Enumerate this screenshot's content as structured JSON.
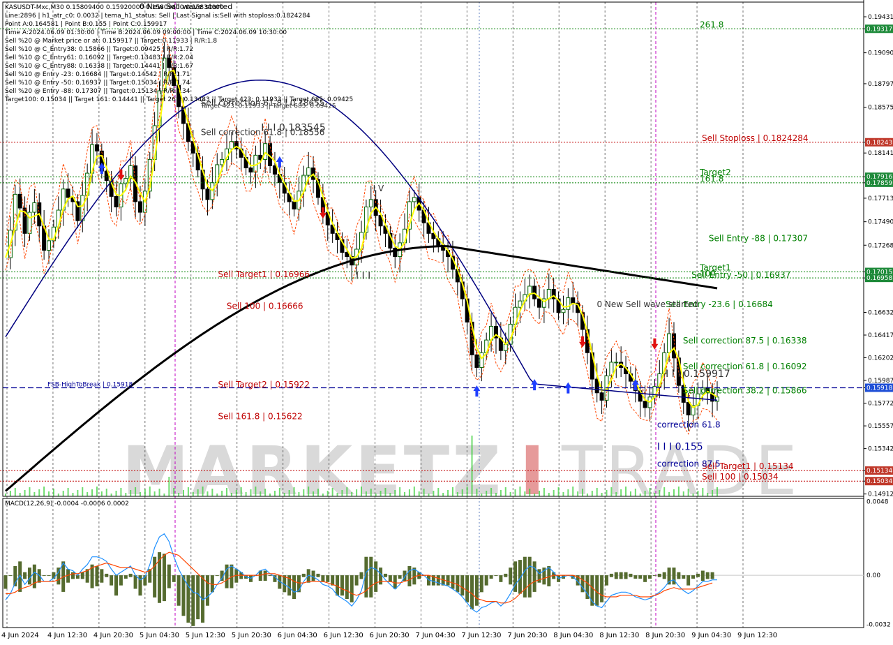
{
  "colors": {
    "background": "#ffffff",
    "border": "#000000",
    "grid": "#c8c8c8",
    "axis_text": "#000000",
    "candle_up": "#006400",
    "candle_down": "#000000",
    "sma_fast": "#ffff00",
    "ma_blue": "#000080",
    "ma_black": "#000000",
    "band": "#ff4500",
    "fsb_line": "#000096",
    "level_red": "#c00000",
    "level_green": "#008000",
    "level_dark": "#333333",
    "macd_line": "#1e90ff",
    "signal_line": "#ff4500",
    "histogram": "#556b2f",
    "volume": "#32cd32",
    "price_badge_red": "#c0392b",
    "price_badge_green": "#1e8a3a",
    "price_badge_blue": "#1f4fd6",
    "session_line": "#c000c0",
    "watermark": "#d9d9d9",
    "watermark_red": "#e69a9a"
  },
  "header_lines": [
    "KASUSDT-Mxc,M30  0.15809400 0.15920000 0.15809400 0.15830000",
    "Line:2896 | h1_atr_c0: 0.0032 | tema_h1_status: Sell | Last Signal is:Sell with stoploss:0.1824284",
    "Point A:0.164581 | Point B:0.155 | Point C:0.159917",
    "Time A:2024.06.09 01:30:00 | Time B:2024.06.09 09:00:00 | Time C:2024.06.09 10:30:00",
    "Sell %20 @ Market price or at: 0.159917 || Target:0.11933 | R/R:1.8",
    "Sell %10 @ C_Entry38: 0.15866 || Target:0.09425 | R/R:1.72",
    "Sell %10 @ C_Entry61: 0.16092 || Target:0.13483 | R/R:2.04",
    "Sell %10 @ C_Entry88: 0.16338 || Target:0.14441 | R/R:1.67",
    "Sell %10 @ Entry -23: 0.16684 || Target:0.14542 | R/R:1.71",
    "Sell %10 @ Entry -50: 0.16937 || Target:0.15034 | R/R:1.74",
    "Sell %20 @ Entry -88: 0.17307 || Target:0.15134 | R/R:2.34",
    "Target100: 0.15034 || Target 161: 0.14441 || Target 261: 0.13483 || Target 423: 0.11933 || Target 685: 0.09425"
  ],
  "header_overlay": "0 New Sell wave started",
  "chart_data": {
    "type": "line",
    "symbol": "KASUSDT-Mxc,M30",
    "ylim": [
      0.1489,
      0.1957
    ],
    "y_ticks": [
      "0.19431",
      "0.19317",
      "0.19090",
      "0.18797",
      "0.18575",
      "0.18243",
      "0.18141",
      "0.17916",
      "0.17859",
      "0.17713",
      "0.17490",
      "0.17268",
      "0.17015",
      "0.16958",
      "0.16632",
      "0.16417",
      "0.16202",
      "0.15987",
      "0.15918",
      "0.15772",
      "0.15557",
      "0.15342",
      "0.15134",
      "0.15034",
      "0.14912"
    ],
    "x_ticks": [
      "4 Jun 2024",
      "4 Jun 12:30",
      "4 Jun 20:30",
      "5 Jun 04:30",
      "5 Jun 12:30",
      "5 Jun 20:30",
      "6 Jun 04:30",
      "6 Jun 12:30",
      "6 Jun 20:30",
      "7 Jun 04:30",
      "7 Jun 12:30",
      "7 Jun 20:30",
      "8 Jun 04:30",
      "8 Jun 12:30",
      "8 Jun 20:30",
      "9 Jun 04:30",
      "9 Jun 12:30"
    ],
    "badges": [
      {
        "price": "0.19317",
        "kind": "green"
      },
      {
        "price": "0.18243",
        "kind": "red"
      },
      {
        "price": "0.17916",
        "kind": "green"
      },
      {
        "price": "0.17859",
        "kind": "green"
      },
      {
        "price": "0.17015",
        "kind": "green"
      },
      {
        "price": "0.16958",
        "kind": "green"
      },
      {
        "price": "0.15918",
        "kind": "blue"
      },
      {
        "price": "0.15134",
        "kind": "red"
      },
      {
        "price": "0.15034",
        "kind": "red"
      }
    ],
    "levels": [
      {
        "price": 0.19317,
        "label": "261.8",
        "color": "green",
        "style": "dash"
      },
      {
        "price": 0.18243,
        "label": "Sell Stoploss | 0.1824284",
        "color": "red",
        "style": "dash"
      },
      {
        "price": 0.17916,
        "label": "Target2",
        "color": "green",
        "style": "dash"
      },
      {
        "price": 0.17859,
        "label": "161.8",
        "color": "green",
        "style": "dash"
      },
      {
        "price": 0.17015,
        "label": "Target1",
        "color": "green",
        "style": "dash"
      },
      {
        "price": 0.16958,
        "label": "100",
        "color": "green",
        "style": "dash"
      },
      {
        "price": 0.15918,
        "label": "FSB-HighToBreak | 0.15918",
        "color": "blue",
        "style": "dash"
      },
      {
        "price": 0.15134,
        "label": "Sell Target1 | 0.15134",
        "color": "red",
        "style": "dash"
      },
      {
        "price": 0.15034,
        "label": "Sell 100 | 0.15034",
        "color": "red",
        "style": "dash"
      }
    ],
    "annotations": [
      {
        "text": "Sell Entry -88 | 0.17307",
        "price": 0.17307,
        "x_frac": 0.82,
        "color": "green"
      },
      {
        "text": "Sell Entry -50 | 0.16937",
        "price": 0.16958,
        "x_frac": 0.8,
        "color": "green"
      },
      {
        "text": "Sell Entry -23.6 | 0.16684",
        "price": 0.1668,
        "x_frac": 0.77,
        "color": "green"
      },
      {
        "text": "Sell correction 87.5 | 0.16338",
        "price": 0.16338,
        "x_frac": 0.79,
        "color": "green"
      },
      {
        "text": "Sell correction 61.8 | 0.16092",
        "price": 0.16092,
        "x_frac": 0.79,
        "color": "green"
      },
      {
        "text": "Sell correction 38.2 | 0.15866",
        "price": 0.15866,
        "x_frac": 0.79,
        "color": "green"
      },
      {
        "text": "Sell Target1 | 0.16966",
        "price": 0.16966,
        "x_frac": 0.25,
        "color": "red"
      },
      {
        "text": "Sell 100 | 0.16666",
        "price": 0.16666,
        "x_frac": 0.26,
        "color": "red"
      },
      {
        "text": "Sell Target2 | 0.15922",
        "price": 0.15922,
        "x_frac": 0.25,
        "color": "red"
      },
      {
        "text": "Sell 161.8 | 0.15622",
        "price": 0.15622,
        "x_frac": 0.25,
        "color": "red"
      },
      {
        "text": "I I I 0.183545",
        "price": 0.1835,
        "x_frac": 0.3,
        "color": "dark"
      },
      {
        "text": "I I I 0.159917",
        "price": 0.1602,
        "x_frac": 0.77,
        "color": "dark"
      },
      {
        "text": "I I I 0.155",
        "price": 0.1533,
        "x_frac": 0.76,
        "color": "blue"
      },
      {
        "text": "correction 61.8",
        "price": 0.1554,
        "x_frac": 0.76,
        "color": "blue"
      },
      {
        "text": "correction 87.5",
        "price": 0.1517,
        "x_frac": 0.76,
        "color": "blue"
      },
      {
        "text": "I V",
        "price": 0.1778,
        "x_frac": 0.43,
        "color": "dark"
      },
      {
        "text": "I I I",
        "price": 0.1695,
        "x_frac": 0.41,
        "color": "dark"
      },
      {
        "text": "0 New Sell wave started",
        "price": 0.1668,
        "x_frac": 0.69,
        "color": "dark"
      },
      {
        "text": "Sell correction 61.8 | 0.18556",
        "price": 0.1831,
        "x_frac": 0.23,
        "color": "dark"
      },
      {
        "text": "Target 423: 0.11933 || Target 685: 0.09425",
        "price": 0.1857,
        "x_frac": 0.23,
        "color": "dark"
      },
      {
        "text": "Sell correction 61.8 | 0.18655",
        "price": 0.1859,
        "x_frac": 0.23,
        "color": "dark"
      }
    ],
    "series": [
      {
        "name": "close",
        "values": [
          0.1715,
          0.1741,
          0.1775,
          0.1762,
          0.1738,
          0.1758,
          0.1767,
          0.1745,
          0.1722,
          0.1731,
          0.1744,
          0.176,
          0.178,
          0.1772,
          0.1768,
          0.175,
          0.1774,
          0.1795,
          0.1822,
          0.1816,
          0.1797,
          0.1788,
          0.1773,
          0.1763,
          0.1785,
          0.179,
          0.1802,
          0.1768,
          0.1758,
          0.1778,
          0.1808,
          0.184,
          0.1873,
          0.1904,
          0.1895,
          0.1878,
          0.1858,
          0.1842,
          0.1825,
          0.1814,
          0.1798,
          0.178,
          0.177,
          0.1786,
          0.1803,
          0.1808,
          0.1818,
          0.1825,
          0.1818,
          0.181,
          0.18,
          0.1796,
          0.1812,
          0.1808,
          0.1823,
          0.1802,
          0.1794,
          0.1786,
          0.1776,
          0.1768,
          0.1761,
          0.1778,
          0.1793,
          0.18,
          0.1789,
          0.1772,
          0.1758,
          0.1746,
          0.1738,
          0.1732,
          0.172,
          0.1716,
          0.1708,
          0.1723,
          0.1739,
          0.1763,
          0.177,
          0.1755,
          0.1745,
          0.1738,
          0.1724,
          0.1716,
          0.1729,
          0.1742,
          0.1768,
          0.1772,
          0.176,
          0.1748,
          0.1738,
          0.1733,
          0.1727,
          0.1722,
          0.1716,
          0.1704,
          0.1692,
          0.1676,
          0.1654,
          0.1623,
          0.1611,
          0.1625,
          0.1637,
          0.165,
          0.1639,
          0.1627,
          0.1633,
          0.1652,
          0.1668,
          0.1674,
          0.168,
          0.1688,
          0.1676,
          0.1668,
          0.1676,
          0.1685,
          0.1676,
          0.1663,
          0.1666,
          0.1677,
          0.1672,
          0.1663,
          0.1647,
          0.1625,
          0.16,
          0.1587,
          0.158,
          0.1603,
          0.1616,
          0.1616,
          0.1611,
          0.1605,
          0.1598,
          0.1589,
          0.1579,
          0.1573,
          0.1583,
          0.1593,
          0.1605,
          0.1625,
          0.1643,
          0.162,
          0.1594,
          0.1578,
          0.1566,
          0.1575,
          0.1586,
          0.1592,
          0.1587,
          0.1579,
          0.1583
        ]
      },
      {
        "name": "macd",
        "values": [
          -0.0016,
          -0.0012,
          -0.0005,
          0.0,
          -0.0006,
          -0.0002,
          0.0002,
          0.0,
          -0.0004,
          -0.0004,
          -0.0002,
          0.0002,
          0.0008,
          0.0004,
          0.0003,
          0.0,
          0.0004,
          0.0007,
          0.0012,
          0.0012,
          0.0011,
          0.0009,
          0.0004,
          0.0,
          0.0002,
          0.0004,
          0.0006,
          0.0,
          -0.0003,
          -0.0001,
          0.0007,
          0.0018,
          0.0025,
          0.0027,
          0.0022,
          0.0012,
          0.0004,
          -0.0002,
          -0.0007,
          -0.0011,
          -0.0012,
          -0.0016,
          -0.0014,
          -0.0011,
          -0.0006,
          -0.0002,
          0.0004,
          0.0006,
          0.0004,
          0.0002,
          -0.0001,
          -0.0002,
          0.0,
          0.0003,
          0.0004,
          0.0001,
          -0.0001,
          -0.0004,
          -0.0006,
          -0.0008,
          -0.0011,
          -0.001,
          -0.0004,
          0.0,
          -0.0001,
          -0.0003,
          -0.0006,
          -0.0007,
          -0.0009,
          -0.0013,
          -0.0015,
          -0.0017,
          -0.002,
          -0.0016,
          -0.001,
          0.0002,
          0.0005,
          0.0004,
          0.0001,
          -0.0003,
          -0.0006,
          -0.0009,
          -0.0006,
          -0.0001,
          0.0003,
          0.0004,
          0.0002,
          0.0,
          -0.0003,
          -0.0004,
          -0.0005,
          -0.0006,
          -0.0007,
          -0.0009,
          -0.0011,
          -0.0014,
          -0.0018,
          -0.0022,
          -0.0024,
          -0.0021,
          -0.002,
          -0.0018,
          -0.0017,
          -0.002,
          -0.0017,
          -0.0012,
          -0.0006,
          -0.0002,
          0.0003,
          0.0006,
          0.0005,
          0.0001,
          0.0003,
          0.0005,
          0.0002,
          -0.0002,
          -0.0001,
          0.0,
          -0.0001,
          -0.0004,
          -0.0008,
          -0.0012,
          -0.0017,
          -0.002,
          -0.0021,
          -0.0017,
          -0.0013,
          -0.0012,
          -0.0011,
          -0.0011,
          -0.0012,
          -0.0014,
          -0.0015,
          -0.0016,
          -0.0015,
          -0.0013,
          -0.0011,
          -0.0008,
          -0.0004,
          -0.0003,
          -0.0007,
          -0.001,
          -0.0012,
          -0.001,
          -0.0007,
          -0.0004,
          -0.0004,
          -0.0003,
          -0.0003
        ]
      },
      {
        "name": "signal",
        "values": [
          -0.0012,
          -0.0012,
          -0.0011,
          -0.0009,
          -0.0008,
          -0.0007,
          -0.0005,
          -0.0004,
          -0.0004,
          -0.0004,
          -0.0004,
          -0.0003,
          -0.0001,
          0.0,
          0.0001,
          0.0001,
          0.0002,
          0.0003,
          0.0005,
          0.0006,
          0.0007,
          0.0008,
          0.0007,
          0.0006,
          0.0005,
          0.0005,
          0.0005,
          0.0004,
          0.0003,
          0.0002,
          0.0003,
          0.0006,
          0.001,
          0.0013,
          0.0015,
          0.0014,
          0.0013,
          0.001,
          0.0007,
          0.0004,
          0.0001,
          -0.0002,
          -0.0005,
          -0.0006,
          -0.0006,
          -0.0005,
          -0.0003,
          -0.0001,
          0.0,
          0.0,
          0.0,
          0.0,
          0.0,
          0.0,
          0.0001,
          0.0001,
          0.0001,
          0.0,
          -0.0001,
          -0.0002,
          -0.0004,
          -0.0005,
          -0.0005,
          -0.0004,
          -0.0004,
          -0.0004,
          -0.0004,
          -0.0005,
          -0.0006,
          -0.0007,
          -0.0009,
          -0.001,
          -0.0012,
          -0.0013,
          -0.0012,
          -0.001,
          -0.0007,
          -0.0005,
          -0.0004,
          -0.0004,
          -0.0004,
          -0.0005,
          -0.0005,
          -0.0004,
          -0.0003,
          -0.0001,
          0.0,
          0.0,
          0.0,
          -0.0001,
          -0.0002,
          -0.0003,
          -0.0004,
          -0.0005,
          -0.0006,
          -0.0008,
          -0.001,
          -0.0012,
          -0.0015,
          -0.0016,
          -0.0017,
          -0.0017,
          -0.0017,
          -0.0018,
          -0.0018,
          -0.0017,
          -0.0015,
          -0.0012,
          -0.0009,
          -0.0006,
          -0.0004,
          -0.0003,
          -0.0002,
          -0.0001,
          0.0,
          0.0,
          0.0,
          0.0,
          0.0,
          -0.0001,
          -0.0003,
          -0.0005,
          -0.0008,
          -0.0011,
          -0.0013,
          -0.0014,
          -0.0014,
          -0.0014,
          -0.0013,
          -0.0013,
          -0.0013,
          -0.0013,
          -0.0014,
          -0.0014,
          -0.0014,
          -0.0013,
          -0.0012,
          -0.001,
          -0.0009,
          -0.0008,
          -0.0009,
          -0.0009,
          -0.0009,
          -0.0009,
          -0.0008,
          -0.0007,
          -0.0006,
          -0.0005
        ]
      }
    ],
    "macd_panel": {
      "label": "MACD(12,26,9) -0.0004 -0.0006 0.0002",
      "ylim": [
        -0.0034,
        0.005
      ],
      "y_ticks": [
        "0.0048",
        "0.00",
        "-0.0032"
      ]
    },
    "watermark": {
      "part1": "MARKETZ",
      "part2": "I",
      "part3": "TRADE"
    },
    "grid": true,
    "legend": "none"
  }
}
